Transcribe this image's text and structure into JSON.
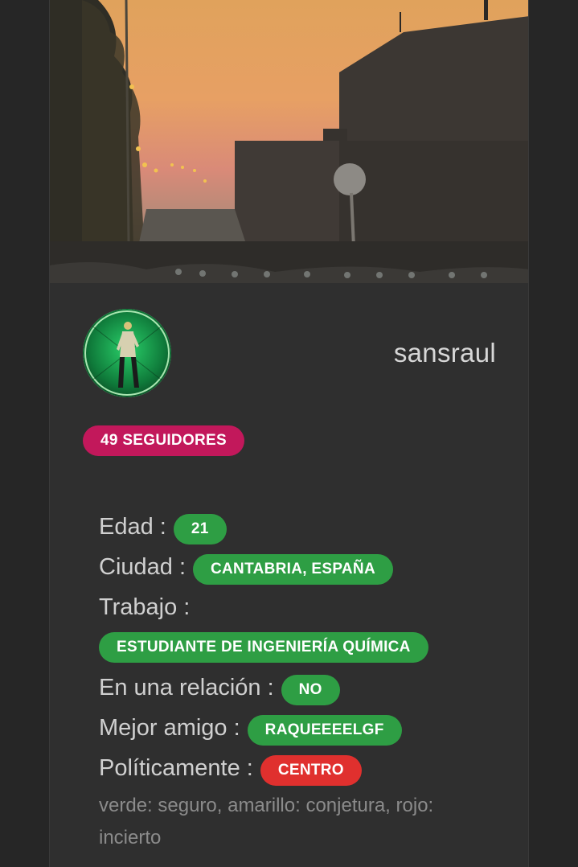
{
  "profile": {
    "username": "sansraul",
    "followers_badge": "49 SEGUIDORES"
  },
  "details": {
    "age_label": "Edad :",
    "age_value": "21",
    "city_label": "Ciudad :",
    "city_value": "CANTABRIA, ESPAÑA",
    "job_label": "Trabajo :",
    "job_value": "ESTUDIANTE DE INGENIERÍA QUÍMICA",
    "relationship_label": "En una relación :",
    "relationship_value": "NO",
    "best_friend_label": "Mejor amigo :",
    "best_friend_value": "RAQUEEEELGF",
    "politics_label": "Políticamente :",
    "politics_value": "CENTRO"
  },
  "legend": "verde: seguro, amarillo: conjetura, rojo: incierto",
  "colors": {
    "background": "#262626",
    "card": "#2f2f2f",
    "followers_badge": "#c2185b",
    "certain": "#2e9e44",
    "uncertain": "#e0302e"
  }
}
